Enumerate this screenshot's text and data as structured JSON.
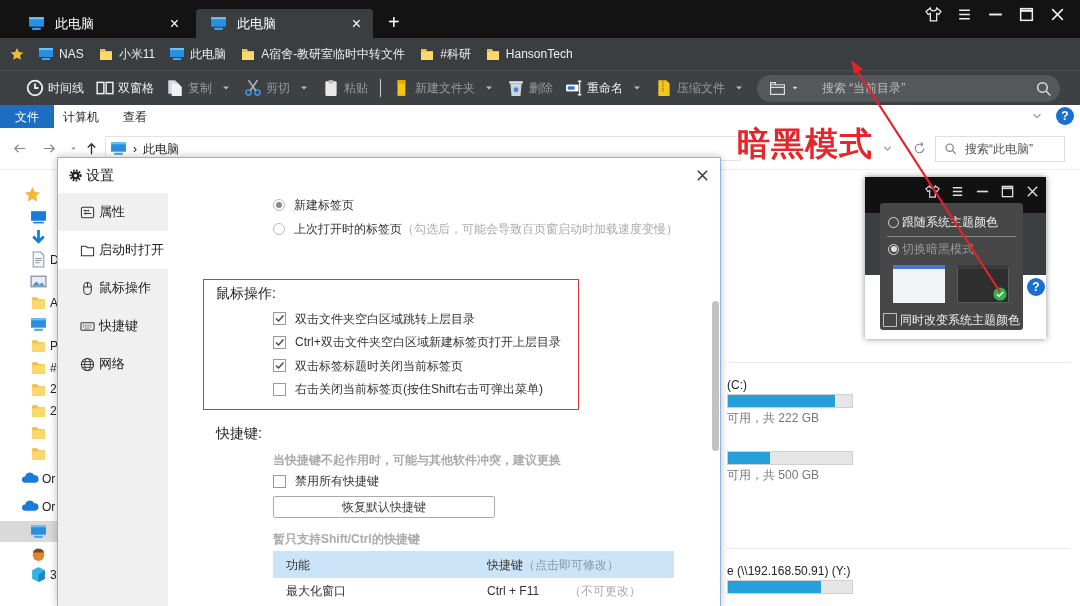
{
  "tabs": [
    {
      "label": "此电脑",
      "selected": false,
      "close": "×"
    },
    {
      "label": "此电脑",
      "selected": true,
      "close": "×"
    }
  ],
  "new_tab": "+",
  "bookmarks": [
    {
      "label": "NAS",
      "kind": "computer"
    },
    {
      "label": "小米11",
      "kind": "folder"
    },
    {
      "label": "此电脑",
      "kind": "computer"
    },
    {
      "label": "A宿舍-教研室临时中转文件",
      "kind": "folder"
    },
    {
      "label": "#科研",
      "kind": "folder"
    },
    {
      "label": "HansonTech",
      "kind": "folder"
    }
  ],
  "toolbar": [
    {
      "label": "时间线",
      "kind": "clock",
      "disabled": false,
      "dropdown": false,
      "separator_before": false
    },
    {
      "label": "双窗格",
      "kind": "panes",
      "disabled": false,
      "dropdown": false,
      "separator_before": false
    },
    {
      "label": "复制",
      "kind": "copy",
      "disabled": true,
      "dropdown": true,
      "separator_before": false
    },
    {
      "label": "剪切",
      "kind": "cut",
      "disabled": true,
      "dropdown": true,
      "separator_before": false
    },
    {
      "label": "粘贴",
      "kind": "paste",
      "disabled": true,
      "dropdown": false,
      "separator_before": false
    },
    {
      "label": "新建文件夹",
      "kind": "newfolder",
      "disabled": true,
      "dropdown": true,
      "separator_before": true
    },
    {
      "label": "删除",
      "kind": "delete",
      "disabled": true,
      "dropdown": false,
      "separator_before": false
    },
    {
      "label": "重命名",
      "kind": "rename",
      "disabled": false,
      "dropdown": true,
      "separator_before": false
    },
    {
      "label": "压缩文件",
      "kind": "zip",
      "disabled": true,
      "dropdown": true,
      "separator_before": false
    }
  ],
  "toolbar_search": {
    "placeholder": "搜索 “当前目录”"
  },
  "ribbon_tabs": [
    {
      "label": "文件",
      "selected": true
    },
    {
      "label": "计算机",
      "selected": false
    },
    {
      "label": "查看",
      "selected": false
    }
  ],
  "ribbon_help": "?",
  "address": {
    "separator": "›",
    "location": "此电脑",
    "search_placeholder": "搜索“此电脑”"
  },
  "nav_pane": [
    {
      "kind": "star",
      "selected": false
    },
    {
      "kind": "desktop",
      "selected": false
    },
    {
      "kind": "download",
      "selected": false
    },
    {
      "kind": "document",
      "label": "D",
      "selected": false
    },
    {
      "kind": "picture",
      "selected": false
    },
    {
      "kind": "folder",
      "label": "A",
      "selected": false
    },
    {
      "kind": "computer",
      "selected": false
    },
    {
      "kind": "folder",
      "label": "P",
      "selected": false
    },
    {
      "kind": "folder",
      "label": "#",
      "selected": false
    },
    {
      "kind": "folder",
      "label": "2",
      "selected": false
    },
    {
      "kind": "folder",
      "label": "2",
      "selected": false
    },
    {
      "kind": "folder",
      "selected": false
    },
    {
      "kind": "folder",
      "selected": false
    },
    {
      "kind": "cloud",
      "label": "Or",
      "selected": false
    },
    {
      "kind": "cloud",
      "label": "Or",
      "selected": false
    },
    {
      "kind": "computer",
      "selected": true
    },
    {
      "kind": "acorn",
      "selected": false
    },
    {
      "kind": "cube",
      "label": "3",
      "selected": false
    }
  ],
  "drives": [
    {
      "name": "(C:)",
      "level": 0.86,
      "space": "可用，共 222 GB"
    },
    {
      "level": 0.34,
      "space": "可用，共 500 GB"
    },
    {
      "name": "e (\\\\192.168.50.91) (Y:)",
      "level": 0.75
    }
  ],
  "settings_dialog": {
    "title": "设置",
    "sidebar": [
      {
        "label": "属性",
        "kind": "properties",
        "selected": false
      },
      {
        "label": "启动时打开",
        "kind": "folder-outline",
        "selected": true
      },
      {
        "label": "鼠标操作",
        "kind": "mouse",
        "selected": false
      },
      {
        "label": "快捷键",
        "kind": "keyboard",
        "selected": false
      },
      {
        "label": "网络",
        "kind": "globe",
        "selected": false
      }
    ],
    "startup_options": [
      {
        "label": "新建标签页",
        "selected": true
      },
      {
        "label": "上次打开时的标签页",
        "note": "（勾选后，可能会导致百页窗启动时加载速度变慢）",
        "selected": false
      }
    ],
    "mouse_section": {
      "heading": "鼠标操作:",
      "options": [
        {
          "label": "双击文件夹空白区域跳转上层目录",
          "checked": true
        },
        {
          "label": "Ctrl+双击文件夹空白区域新建标签页打开上层目录",
          "checked": true
        },
        {
          "label": "双击标签标题时关闭当前标签页",
          "checked": true
        },
        {
          "label": "右击关闭当前标签页(按住Shift右击可弹出菜单)",
          "checked": false
        }
      ]
    },
    "shortcut_section": {
      "heading": "快捷键:",
      "warning": "当快捷键不起作用时，可能与其他软件冲突，建议更换",
      "disable_all": {
        "label": "禁用所有快捷键",
        "checked": false
      },
      "reset_button": "恢复默认快捷键",
      "support_note": "暂只支持Shift/Ctrl的快捷键",
      "columns": [
        {
          "label": "功能"
        },
        {
          "label": "快捷键",
          "note": "（点击即可修改）"
        }
      ],
      "rows": [
        {
          "function": "最大化窗口",
          "shortcut": "Ctrl + F11",
          "note": "（不可更改）"
        }
      ]
    }
  },
  "theme_popup": {
    "options": [
      {
        "label": "跟随系统主题颜色",
        "selected": false,
        "disabled": false
      },
      {
        "label": "切换暗黑模式",
        "selected": true,
        "disabled": true
      }
    ],
    "themes": [
      {
        "kind": "light",
        "selected": false
      },
      {
        "kind": "dark",
        "selected": true
      }
    ],
    "sync_system": {
      "label": "同时改变系统主题颜色",
      "checked": false
    },
    "help": "?"
  },
  "annotation": {
    "text": "暗黑模式"
  }
}
